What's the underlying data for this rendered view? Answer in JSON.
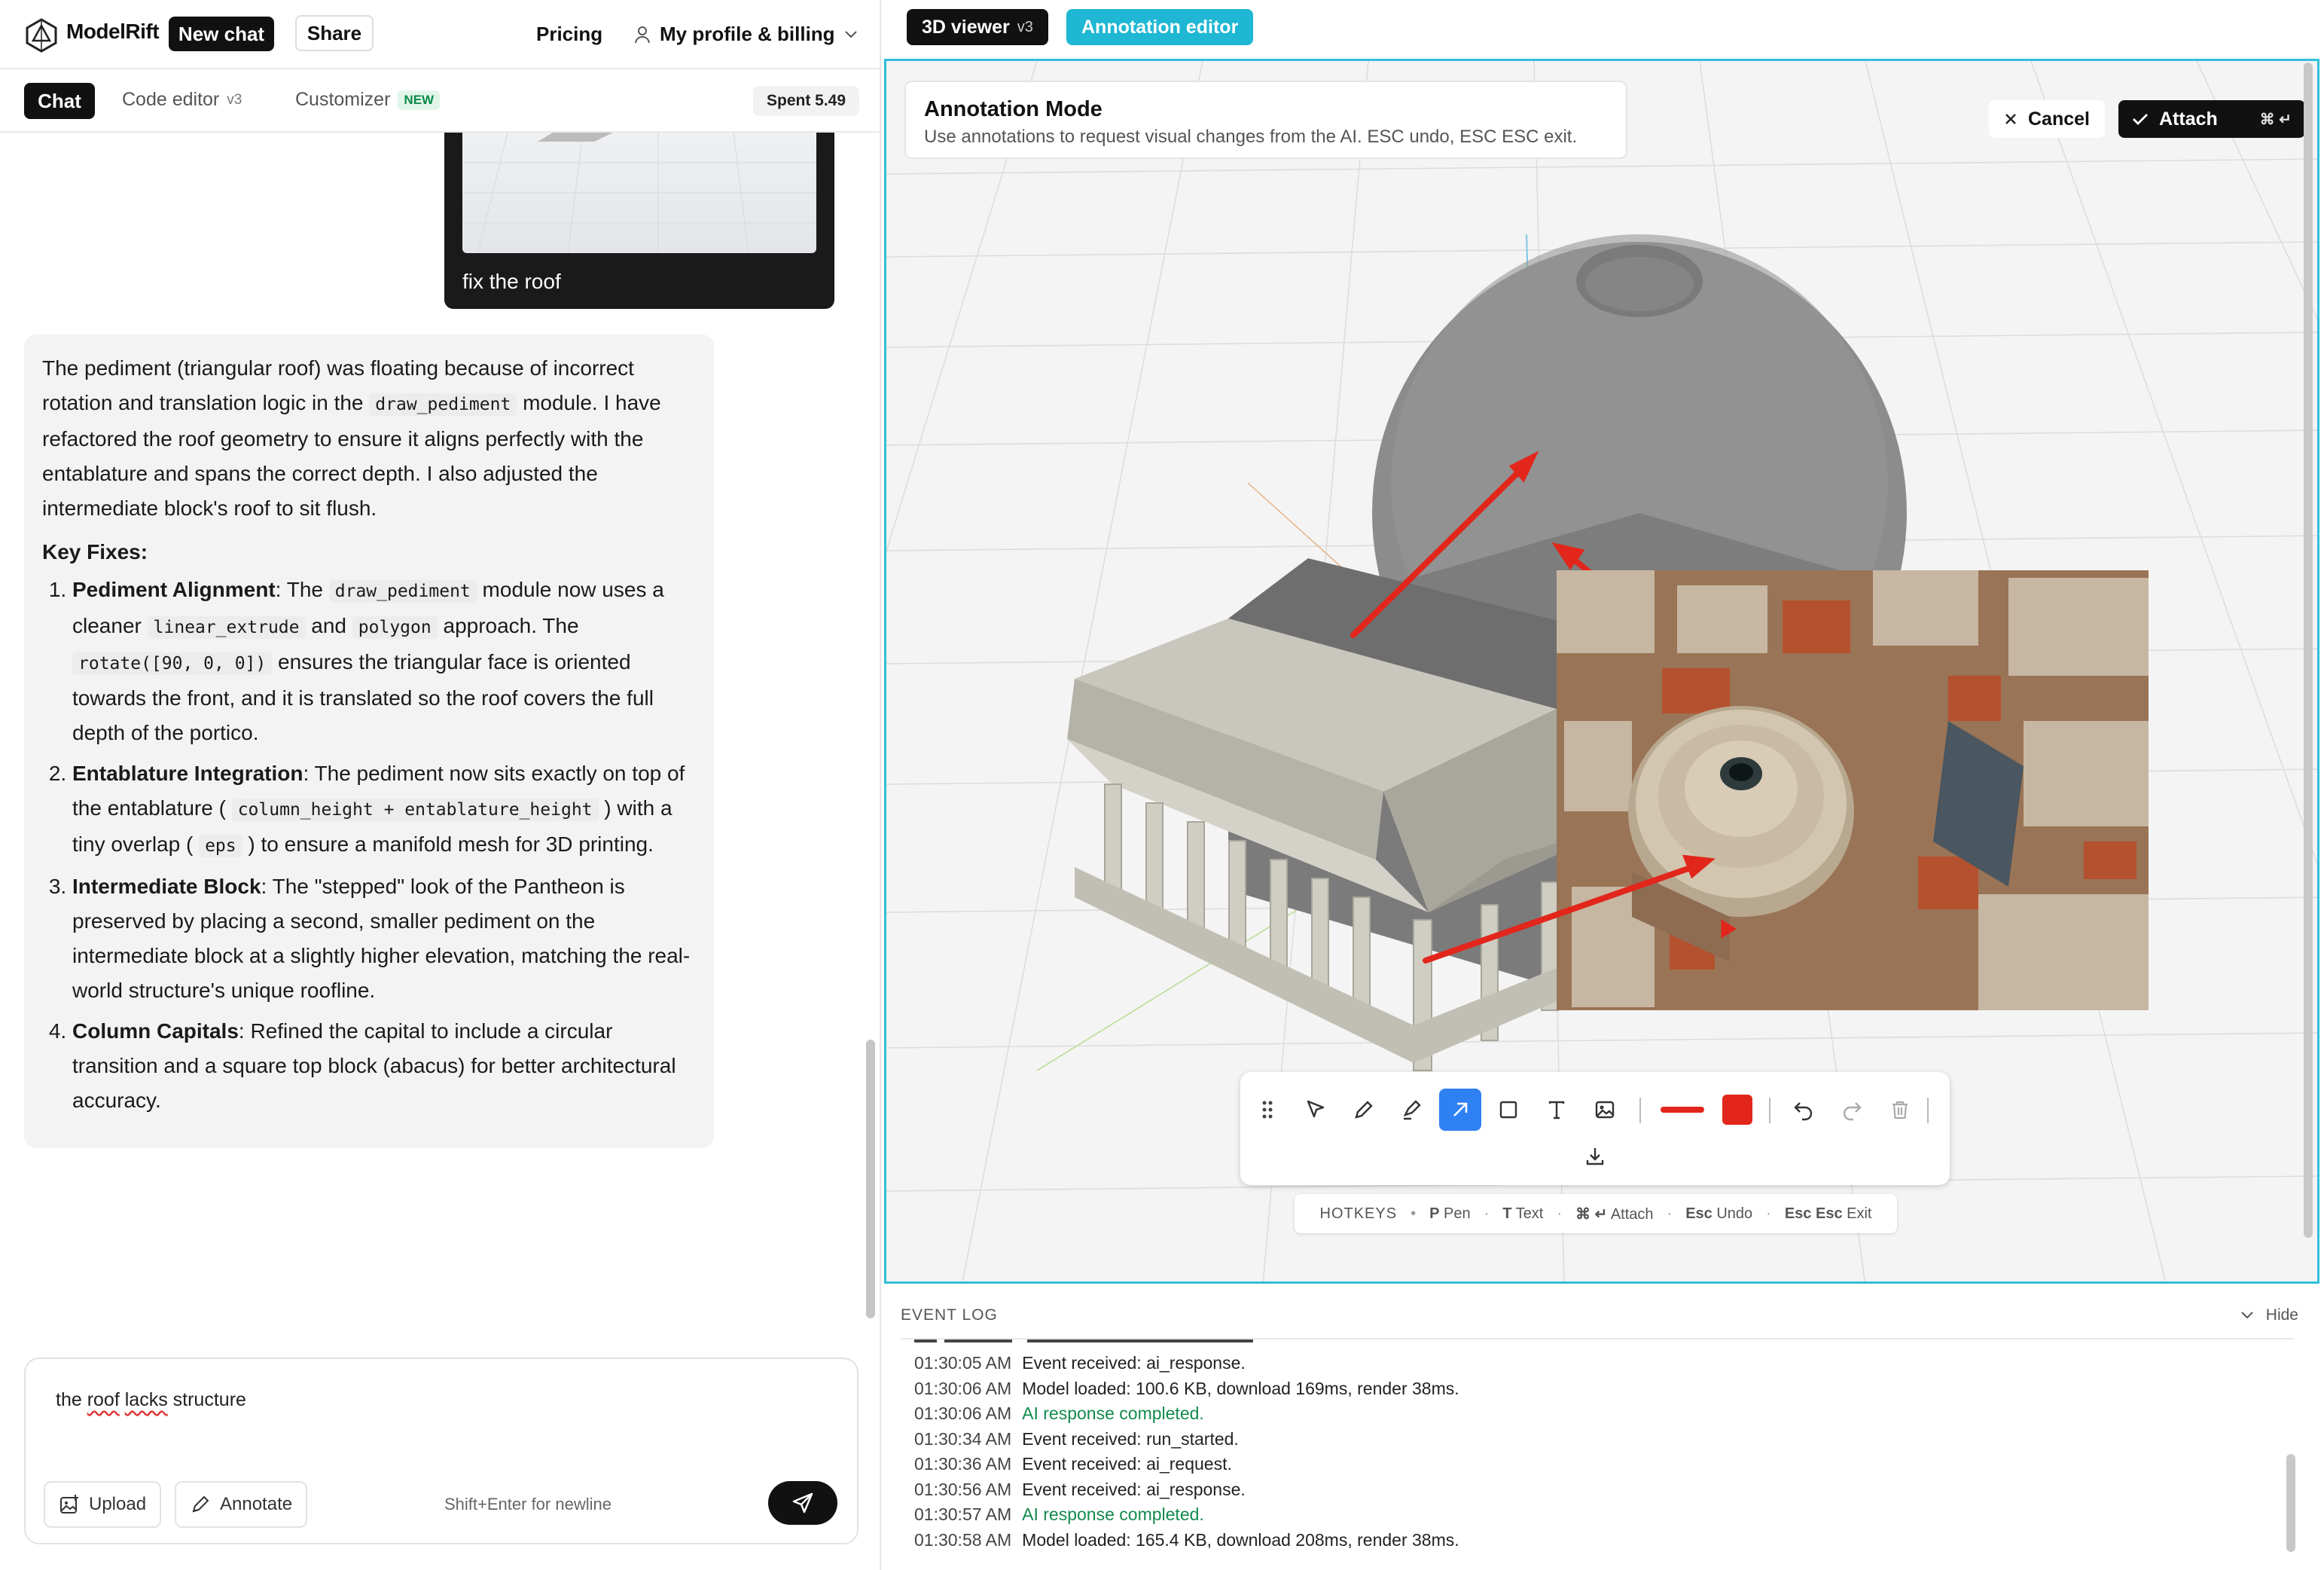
{
  "app": {
    "brand": "ModelRift",
    "new_chat": "New chat",
    "share": "Share",
    "pricing": "Pricing",
    "profile": "My profile & billing"
  },
  "tabs": {
    "chat": "Chat",
    "code_editor": "Code editor",
    "code_version": "v3",
    "customizer": "Customizer",
    "customizer_badge": "NEW",
    "spent": "Spent 5.49"
  },
  "user_message": {
    "caption": "fix the roof"
  },
  "ai_message": {
    "intro_1": "The pediment (triangular roof) was floating because of incorrect rotation and translation logic in the",
    "intro_code": "draw_pediment",
    "intro_2": "module. I have refactored the roof geometry to ensure it aligns perfectly with the entablature and spans the correct depth. I also adjusted the intermediate block's roof to sit flush.",
    "key_fixes": "Key Fixes:",
    "f1_title": "Pediment Alignment",
    "f1_a": ": The",
    "f1_code1": "draw_pediment",
    "f1_b": "module now uses a cleaner",
    "f1_code2": "linear_extrude",
    "f1_c": "and",
    "f1_code3": "polygon",
    "f1_d": "approach. The",
    "f1_code4": "rotate([90, 0, 0])",
    "f1_e": "ensures the triangular face is oriented towards the front, and it is translated so the roof covers the full depth of the portico.",
    "f2_title": "Entablature Integration",
    "f2_a": ": The pediment now sits exactly on top of the entablature (",
    "f2_code1": "column_height + entablature_height",
    "f2_b": ") with a tiny overlap (",
    "f2_code2": "eps",
    "f2_c": ") to ensure a manifold mesh for 3D printing.",
    "f3_title": "Intermediate Block",
    "f3_a": ": The \"stepped\" look of the Pantheon is preserved by placing a second, smaller pediment on the intermediate block at a slightly higher elevation, matching the real-world structure's unique roofline.",
    "f4_title": "Column Capitals",
    "f4_a": ": Refined the capital to include a circular transition and a square top block (abacus) for better architectural accuracy."
  },
  "composer": {
    "text_pre": "the ",
    "text_w1": "roof",
    "text_mid": " ",
    "text_w2": "lacks",
    "text_post": " structure",
    "upload": "Upload",
    "annotate": "Annotate",
    "hint": "Shift+Enter for newline"
  },
  "viewer": {
    "tab_3d": "3D viewer",
    "tab_3d_version": "v3",
    "tab_annot": "Annotation editor",
    "mode_title": "Annotation Mode",
    "mode_desc": "Use annotations to request visual changes from the AI. ESC undo, ESC ESC exit.",
    "cancel": "Cancel",
    "attach": "Attach",
    "attach_keys": "⌘ ↵",
    "annotation_color": "#e2261b",
    "accent": "#31c0d8"
  },
  "hotkeys": {
    "label": "HOTKEYS",
    "p_key": "P",
    "p_label": "Pen",
    "t_key": "T",
    "t_label": "Text",
    "attach_key": "⌘ ↵",
    "attach_label": "Attach",
    "undo_key": "Esc",
    "undo_label": "Undo",
    "exit_key": "Esc Esc",
    "exit_label": "Exit"
  },
  "event_log": {
    "title": "EVENT LOG",
    "hide": "Hide",
    "rows": [
      {
        "ts": "01:30:05 AM",
        "msg": "Event received: ai_response.",
        "ok": false
      },
      {
        "ts": "01:30:06 AM",
        "msg": "Model loaded: 100.6 KB, download 169ms, render 38ms.",
        "ok": false
      },
      {
        "ts": "01:30:06 AM",
        "msg": "AI response completed.",
        "ok": true
      },
      {
        "ts": "01:30:34 AM",
        "msg": "Event received: run_started.",
        "ok": false
      },
      {
        "ts": "01:30:36 AM",
        "msg": "Event received: ai_request.",
        "ok": false
      },
      {
        "ts": "01:30:56 AM",
        "msg": "Event received: ai_response.",
        "ok": false
      },
      {
        "ts": "01:30:57 AM",
        "msg": "AI response completed.",
        "ok": true
      },
      {
        "ts": "01:30:58 AM",
        "msg": "Model loaded: 165.4 KB, download 208ms, render 38ms.",
        "ok": false
      }
    ]
  }
}
